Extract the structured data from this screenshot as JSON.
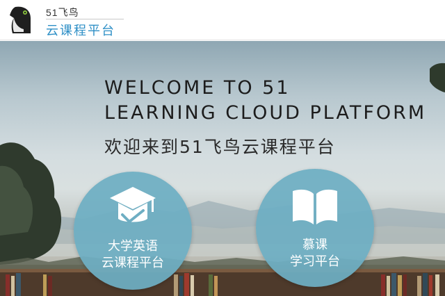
{
  "header": {
    "logo_top": "51飞鸟",
    "logo_bottom": "云课程平台",
    "logo_icon": "bird-logo-icon"
  },
  "hero": {
    "welcome_line1": "WELCOME TO 51",
    "welcome_line2": "LEARNING CLOUD PLATFORM",
    "welcome_cn": "欢迎来到51飞鸟云课程平台"
  },
  "entries": [
    {
      "icon": "graduation-cap-icon",
      "line1": "大学英语",
      "line2": "云课程平台"
    },
    {
      "icon": "open-book-icon",
      "line1": "慕课",
      "line2": "学习平台"
    }
  ],
  "colors": {
    "brand_blue": "#2e8fc6",
    "circle_fill": "#6eaec3",
    "logo_green": "#8cc63f"
  }
}
